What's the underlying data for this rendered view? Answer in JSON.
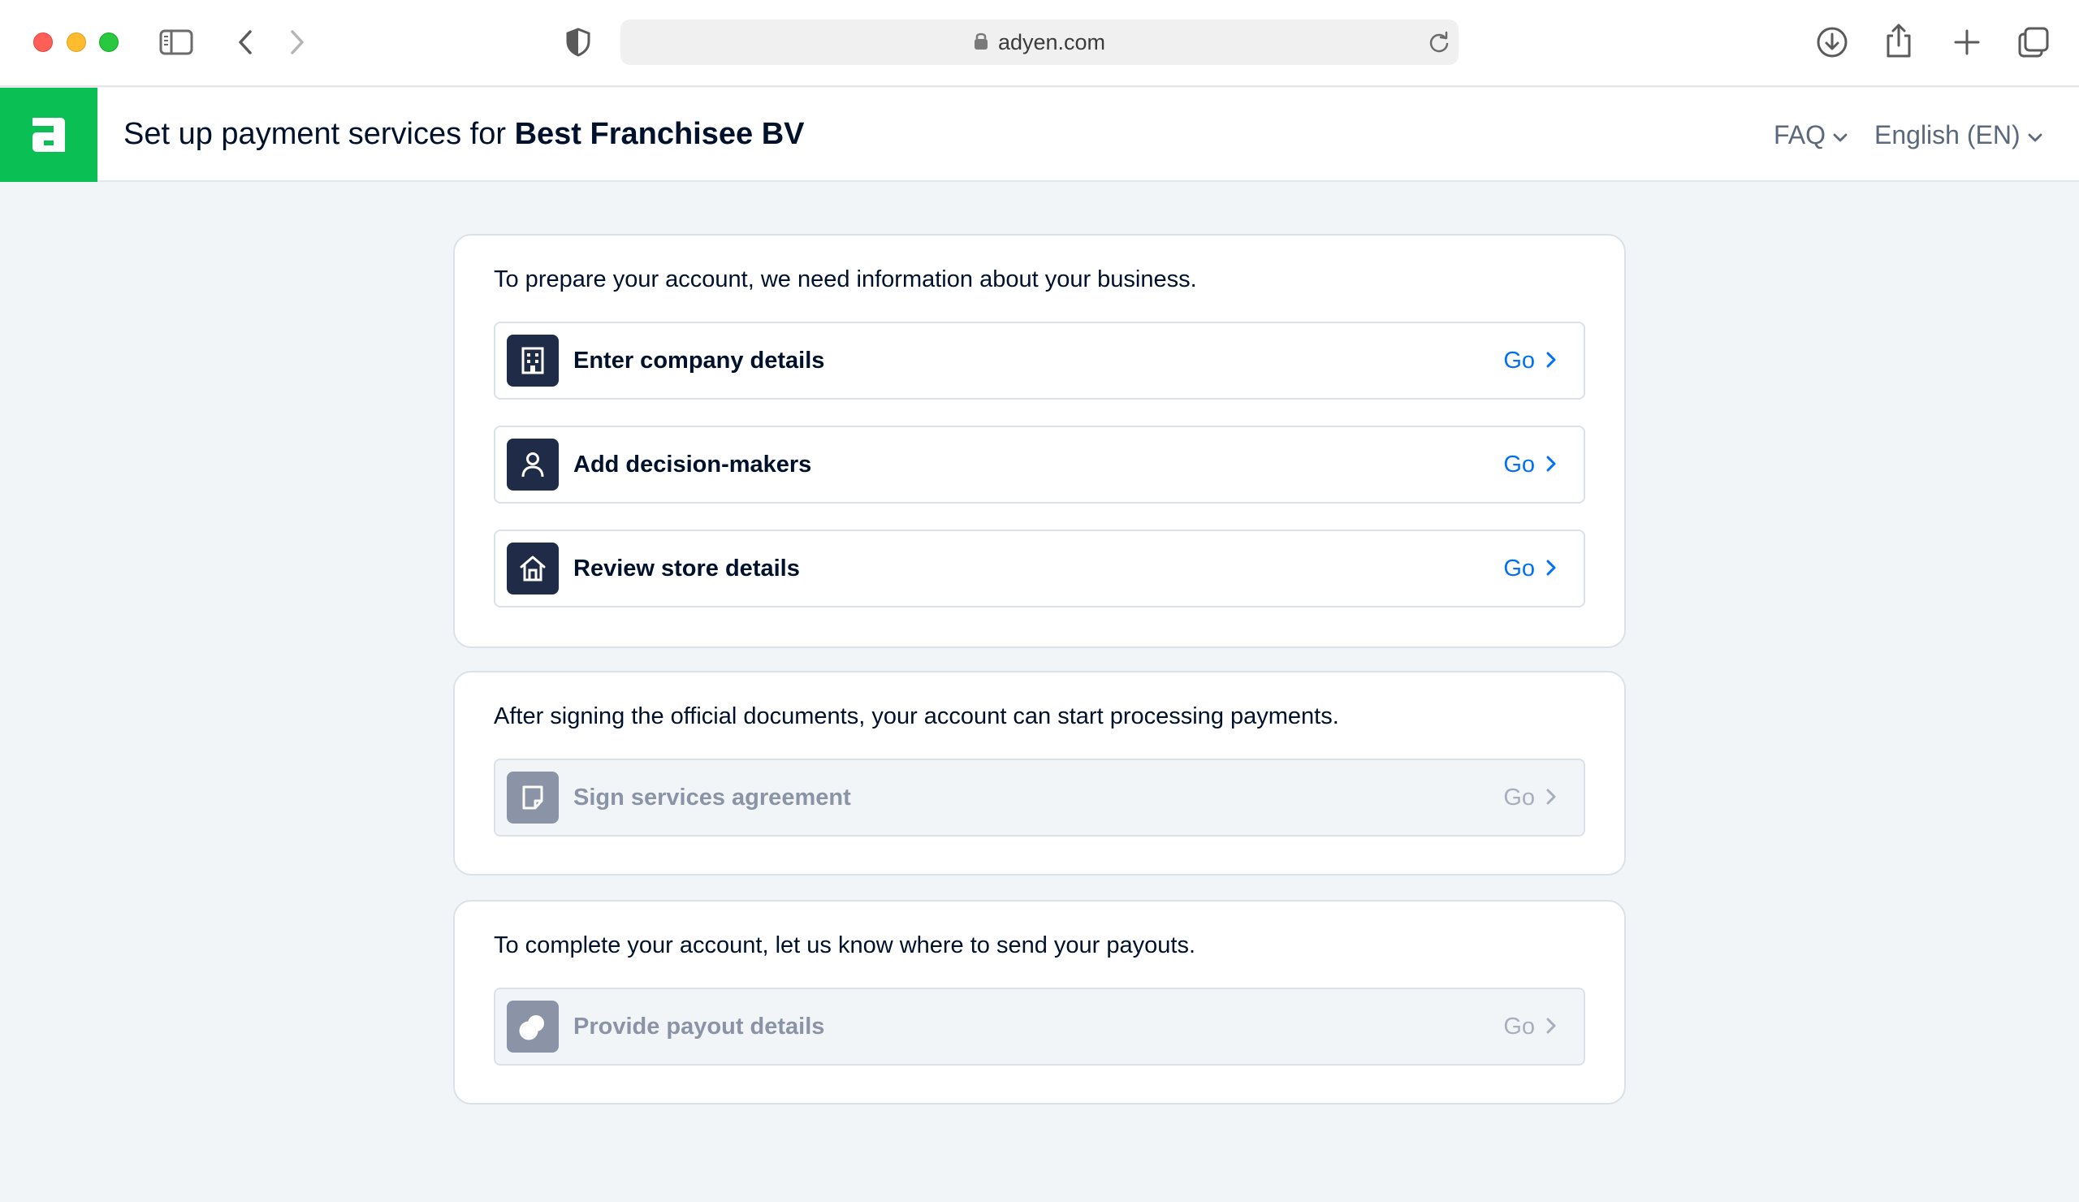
{
  "browser": {
    "url": "adyen.com"
  },
  "header": {
    "title_prefix": "Set up payment services for",
    "company_name": "Best Franchisee BV",
    "faq_label": "FAQ",
    "language_label": "English (EN)"
  },
  "sections": [
    {
      "intro": "To prepare your account, we need information about your business.",
      "tasks": [
        {
          "label": "Enter company details",
          "action": "Go",
          "icon": "building-icon",
          "enabled": true
        },
        {
          "label": "Add decision-makers",
          "action": "Go",
          "icon": "person-icon",
          "enabled": true
        },
        {
          "label": "Review store details",
          "action": "Go",
          "icon": "store-icon",
          "enabled": true
        }
      ]
    },
    {
      "intro": "After signing the official documents, your account can start processing payments.",
      "tasks": [
        {
          "label": "Sign services agreement",
          "action": "Go",
          "icon": "document-icon",
          "enabled": false
        }
      ]
    },
    {
      "intro": "To complete your account, let us know where to send your payouts.",
      "tasks": [
        {
          "label": "Provide payout details",
          "action": "Go",
          "icon": "coins-icon",
          "enabled": false
        }
      ]
    }
  ],
  "colors": {
    "brand_green": "#0abf53",
    "link_blue": "#0070f5",
    "icon_dark": "#1f2b47",
    "disabled_gray": "#8a94a6",
    "page_bg": "#f2f5f7"
  }
}
